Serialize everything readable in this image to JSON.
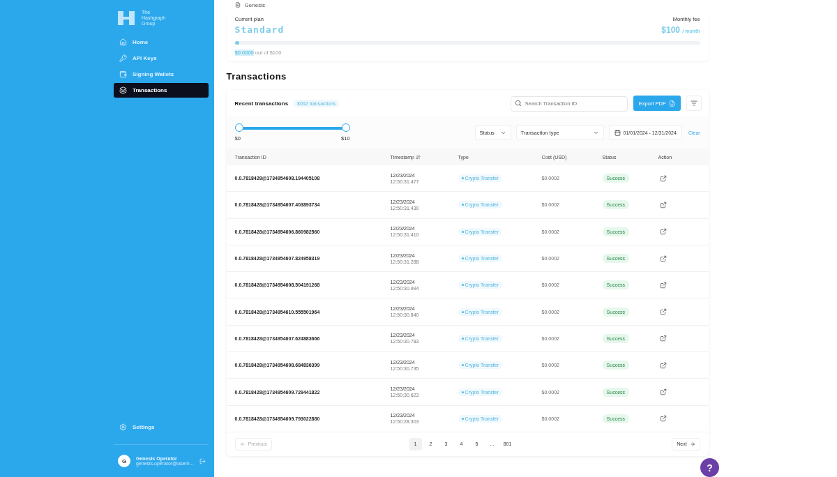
{
  "sidebar": {
    "logo_lines": [
      "The",
      "Hashgraph",
      "Group"
    ],
    "items": [
      {
        "label": "Home",
        "selected": false
      },
      {
        "label": "API Keys",
        "selected": false
      },
      {
        "label": "Signing Wallets",
        "selected": false
      },
      {
        "label": "Transactions",
        "selected": true
      }
    ],
    "settings": "Settings",
    "user": {
      "initial": "G",
      "name": "Genesis Operator",
      "email": "genesis.operator@usern..."
    }
  },
  "network": {
    "label": "Genesis"
  },
  "plan": {
    "current_label": "Current plan",
    "name": "Standard",
    "fee_label": "Monthly fee",
    "fee": "$100",
    "fee_unit": "/ month",
    "usage_used": "$0.0000",
    "usage_rest": " out of $100",
    "level": 0.01
  },
  "transactions": {
    "title": "Transactions",
    "card_title": "Recent transactions",
    "count": "8002 transactions",
    "search": {
      "placeholder": "Search Transaction ID"
    },
    "export": "Export PDF",
    "cost_range": {
      "level": 1,
      "min": "$0",
      "max": "$10"
    },
    "filters": {
      "status": "Status",
      "type": "Transaction type",
      "dates": "01/01/2024 - 12/31/2024",
      "clear": "Clear"
    },
    "columns": [
      "Transaction ID",
      "Timestamp",
      "Type",
      "Cost (USD)",
      "Status",
      "Action"
    ],
    "rows": [
      {
        "id": "0.0.7818428@1734954608.194405108",
        "date": "12/23/2024",
        "time": "12:50:31.477",
        "type": "Crypto Transfer",
        "cost": "$0.0002",
        "status": "Success"
      },
      {
        "id": "0.0.7818428@1734954607.403893734",
        "date": "12/23/2024",
        "time": "12:50:31.430",
        "type": "Crypto Transfer",
        "cost": "$0.0002",
        "status": "Success"
      },
      {
        "id": "0.0.7818428@1734954606.860982560",
        "date": "12/23/2024",
        "time": "12:50:31.410",
        "type": "Crypto Transfer",
        "cost": "$0.0002",
        "status": "Success"
      },
      {
        "id": "0.0.7818428@1734954607.824958319",
        "date": "12/23/2024",
        "time": "12:50:31.288",
        "type": "Crypto Transfer",
        "cost": "$0.0002",
        "status": "Success"
      },
      {
        "id": "0.0.7818428@1734954608.504191268",
        "date": "12/23/2024",
        "time": "12:50:30.994",
        "type": "Crypto Transfer",
        "cost": "$0.0002",
        "status": "Success"
      },
      {
        "id": "0.0.7818428@1734954610.555501964",
        "date": "12/23/2024",
        "time": "12:50:30.840",
        "type": "Crypto Transfer",
        "cost": "$0.0002",
        "status": "Success"
      },
      {
        "id": "0.0.7818428@1734954607.624883666",
        "date": "12/23/2024",
        "time": "12:50:30.783",
        "type": "Crypto Transfer",
        "cost": "$0.0002",
        "status": "Success"
      },
      {
        "id": "0.0.7818428@1734954608.684836399",
        "date": "12/23/2024",
        "time": "12:50:30.735",
        "type": "Crypto Transfer",
        "cost": "$0.0002",
        "status": "Success"
      },
      {
        "id": "0.0.7818428@1734954609.729441822",
        "date": "12/23/2024",
        "time": "12:50:30.623",
        "type": "Crypto Transfer",
        "cost": "$0.0002",
        "status": "Success"
      },
      {
        "id": "0.0.7818428@1734954609.793022880",
        "date": "12/23/2024",
        "time": "12:50:28.303",
        "type": "Crypto Transfer",
        "cost": "$0.0002",
        "status": "Success"
      }
    ],
    "pagination": {
      "previous": {
        "label": "Previous",
        "disabled": true
      },
      "pages": [
        {
          "label": "1",
          "selected": true
        },
        {
          "label": "2",
          "selected": false
        },
        {
          "label": "3",
          "selected": false
        },
        {
          "label": "4",
          "selected": false
        },
        {
          "label": "5",
          "selected": false
        },
        {
          "label": "...",
          "selected": false
        },
        {
          "label": "801",
          "selected": false
        }
      ],
      "next": {
        "label": "Next",
        "disabled": false
      }
    }
  },
  "help": "?"
}
